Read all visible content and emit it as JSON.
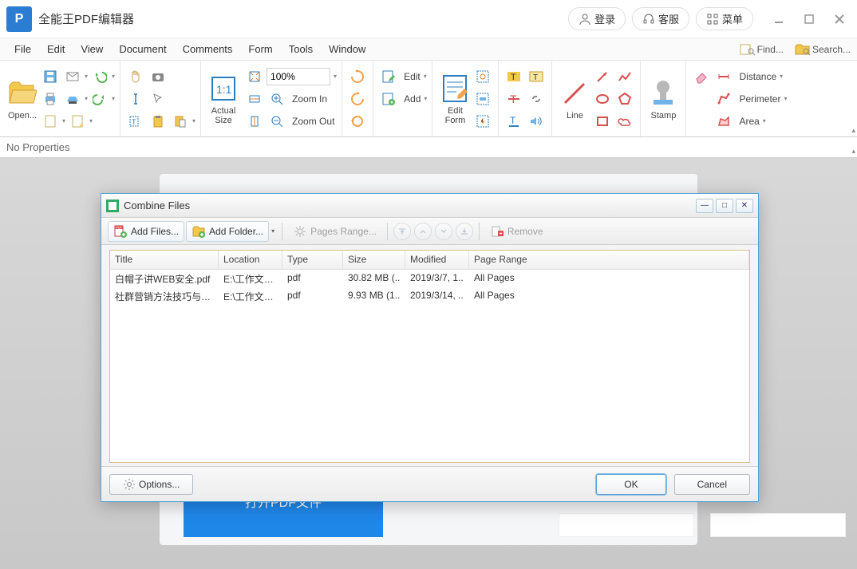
{
  "app": {
    "title": "全能王PDF编辑器",
    "logo_letter": "P"
  },
  "titlebar": {
    "login": "登录",
    "support": "客服",
    "menu": "菜单"
  },
  "menubar": {
    "items": [
      "File",
      "Edit",
      "View",
      "Document",
      "Comments",
      "Form",
      "Tools",
      "Window"
    ],
    "find": "Find...",
    "search": "Search..."
  },
  "ribbon": {
    "open": "Open...",
    "actual_size": "Actual\nSize",
    "zoom_value": "100%",
    "zoom_in": "Zoom In",
    "zoom_out": "Zoom Out",
    "edit": "Edit",
    "add": "Add",
    "edit_form": "Edit\nForm",
    "line": "Line",
    "stamp": "Stamp",
    "distance": "Distance",
    "perimeter": "Perimeter",
    "area": "Area"
  },
  "propbar": {
    "text": "No Properties"
  },
  "start": {
    "open_btn": "打开PDF文件"
  },
  "dialog": {
    "title": "Combine Files",
    "toolbar": {
      "add_files": "Add Files...",
      "add_folder": "Add Folder...",
      "pages_range": "Pages Range...",
      "remove": "Remove"
    },
    "columns": {
      "title": "Title",
      "location": "Location",
      "type": "Type",
      "size": "Size",
      "modified": "Modified",
      "page_range": "Page Range"
    },
    "rows": [
      {
        "title": "白帽子讲WEB安全.pdf",
        "location": "E:\\工作文件\\..",
        "type": "pdf",
        "size": "30.82 MB (..",
        "modified": "2019/3/7, 1..",
        "page_range": "All Pages"
      },
      {
        "title": "社群营销方法技巧与实..",
        "location": "E:\\工作文件\\..",
        "type": "pdf",
        "size": "9.93 MB (1..",
        "modified": "2019/3/14, ..",
        "page_range": "All Pages"
      }
    ],
    "options": "Options...",
    "ok": "OK",
    "cancel": "Cancel"
  }
}
